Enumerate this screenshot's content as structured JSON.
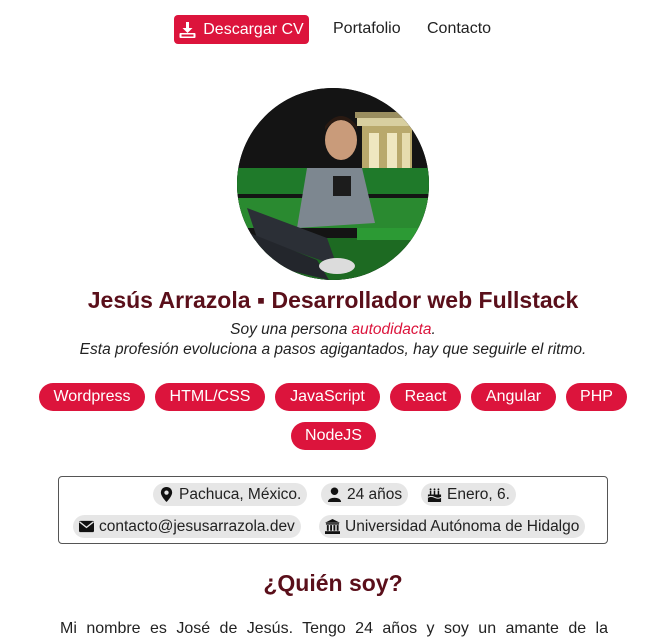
{
  "nav": {
    "cv_label": "Descargar CV",
    "portfolio_label": "Portafolio",
    "contact_label": "Contacto"
  },
  "profile": {
    "headline": "Jesús Arrazola ▪ Desarrollador web Fullstack",
    "bio_prefix": "Soy una persona",
    "bio_highlight": "autodidacta",
    "bio_suffix": ".",
    "bio_line2": "Esta profesión evoluciona a pasos agigantados, hay que seguirle el ritmo."
  },
  "skills": [
    "Wordpress",
    "HTML/CSS",
    "JavaScript",
    "React",
    "Angular",
    "PHP",
    "NodeJS"
  ],
  "info": {
    "location": "Pachuca, México.",
    "age": "24 años",
    "birthday": "Enero, 6.",
    "email": "contacto@jesusarrazola.dev",
    "university": "Universidad Autónoma de Hidalgo"
  },
  "about": {
    "title": "¿Quién soy?",
    "text": "Mi nombre es José de Jesús. Tengo 24 años y soy un amante de la"
  },
  "colors": {
    "accent": "#dc143c",
    "heading": "#5a0f1a",
    "chip_bg": "#e6e6e6"
  },
  "icons": {
    "download": "download-icon",
    "location": "map-marker-icon",
    "age": "user-icon",
    "birthday": "cake-icon",
    "email": "envelope-icon",
    "university": "university-icon"
  }
}
